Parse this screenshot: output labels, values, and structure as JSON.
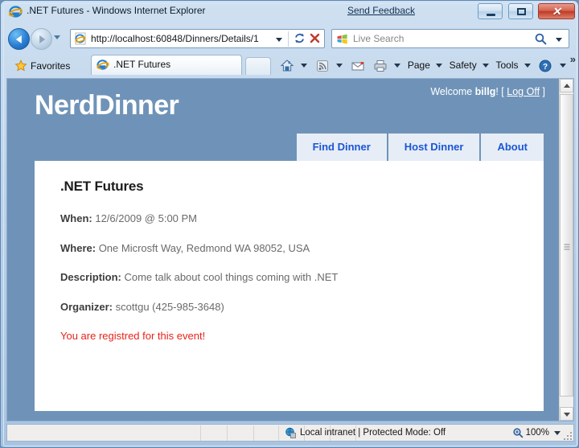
{
  "window": {
    "title": ".NET Futures - Windows Internet Explorer",
    "send_feedback": "Send Feedback",
    "minimize_label": "Minimize",
    "maximize_label": "Maximize",
    "close_label": "✕"
  },
  "navigation": {
    "back_label": "Back",
    "forward_label": "Forward",
    "recent_pages_label": "Recent Pages",
    "address": "http://localhost:60848/Dinners/Details/1",
    "refresh_label": "↻",
    "stop_label": "✕",
    "search_placeholder": "Live Search"
  },
  "tabbar": {
    "favorites_label": "Favorites",
    "tab_label": ".NET Futures",
    "new_tab_label": "New Tab",
    "commands": [
      {
        "name": "home",
        "label": ""
      },
      {
        "name": "feeds",
        "label": ""
      },
      {
        "name": "read-mail",
        "label": ""
      },
      {
        "name": "print",
        "label": ""
      },
      {
        "name": "page",
        "label": "Page"
      },
      {
        "name": "safety",
        "label": "Safety"
      },
      {
        "name": "tools",
        "label": "Tools"
      },
      {
        "name": "help",
        "label": ""
      }
    ],
    "overflow_label": "»"
  },
  "site": {
    "logo": "NerdDinner",
    "welcome_prefix": "Welcome ",
    "user": "billg",
    "welcome_suffix": "! [ ",
    "logoff": "Log Off",
    "welcome_end": " ]",
    "menu": [
      {
        "label": "Find Dinner"
      },
      {
        "label": "Host Dinner"
      },
      {
        "label": "About"
      }
    ]
  },
  "dinner": {
    "title": ".NET Futures",
    "when_label": "When:",
    "when_value": "12/6/2009 @ 5:00 PM",
    "where_label": "Where:",
    "where_value": "One Microsft Way, Redmond WA 98052, USA",
    "description_label": "Description:",
    "description_value": "Come talk about cool things coming with .NET",
    "organizer_label": "Organizer:",
    "organizer_value": "scottgu (425-985-3648)",
    "notice": "You are registred for this event!"
  },
  "statusbar": {
    "zone": "Local intranet | Protected Mode: Off",
    "zoom": "100%"
  },
  "colors": {
    "page_background": "#6f93b8",
    "menu_background": "#e7edf6",
    "menu_text": "#1a56d6",
    "notice_text": "#e8231a",
    "label_text": "#3d3d3d",
    "value_text": "#6a6a6a"
  }
}
